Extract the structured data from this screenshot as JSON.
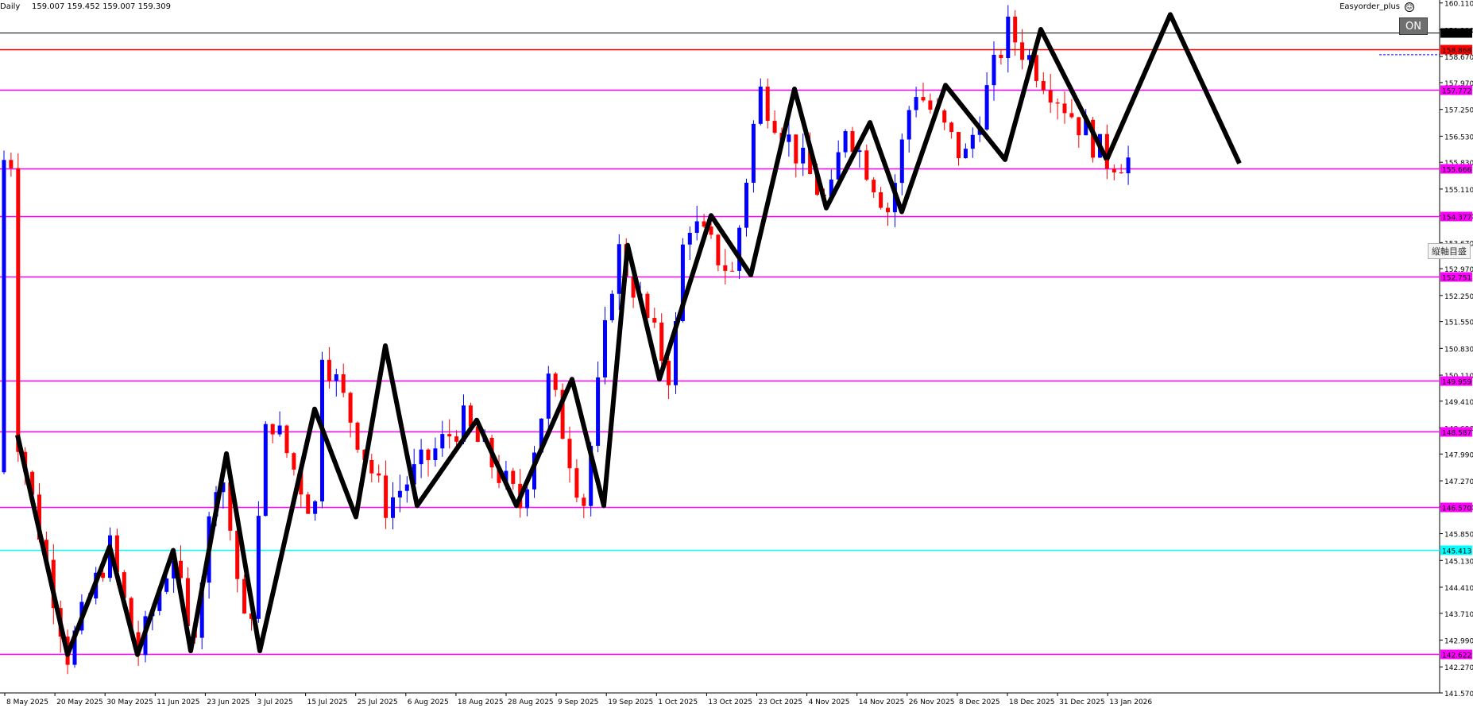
{
  "header": {
    "period": "Daily",
    "ohlc": "159.007 159.452 159.007 159.309"
  },
  "ea": {
    "name": "Easyorder_plus",
    "status_button": "ON"
  },
  "side_button_label": "縦軸目盛",
  "colors": {
    "bull": "#0000ff",
    "bear": "#ff0000",
    "level_line": "#ff00ff",
    "cyan_line": "#00ffff",
    "current_line": "#000000",
    "bid_line": "#ff0000",
    "zigzag": "#000000"
  },
  "chart_data": {
    "type": "candlestick",
    "ylim": [
      141.57,
      160.19
    ],
    "y_ticks": [
      141.57,
      142.27,
      142.99,
      143.71,
      144.41,
      145.13,
      145.85,
      146.57,
      147.27,
      147.99,
      148.69,
      149.41,
      150.11,
      150.83,
      151.55,
      152.25,
      152.97,
      153.67,
      154.39,
      155.11,
      155.83,
      156.53,
      157.25,
      157.97,
      158.67,
      159.39,
      160.11
    ],
    "x_labels": [
      "8 May 2025",
      "20 May 2025",
      "30 May 2025",
      "11 Jun 2025",
      "23 Jun 2025",
      "3 Jul 2025",
      "15 Jul 2025",
      "25 Jul 2025",
      "6 Aug 2025",
      "18 Aug 2025",
      "28 Aug 2025",
      "9 Sep 2025",
      "19 Sep 2025",
      "1 Oct 2025",
      "13 Oct 2025",
      "23 Oct 2025",
      "4 Nov 2025",
      "14 Nov 2025",
      "26 Nov 2025",
      "8 Dec 2025",
      "18 Dec 2025",
      "31 Dec 2025",
      "13 Jan 2026"
    ],
    "horizontal_levels": [
      {
        "value": 159.309,
        "label": "159.309",
        "kind": "current"
      },
      {
        "value": 158.868,
        "label": "158.868",
        "kind": "bid"
      },
      {
        "value": 157.772,
        "label": "157.772",
        "kind": "level"
      },
      {
        "value": 155.666,
        "label": "155.666",
        "kind": "level"
      },
      {
        "value": 154.377,
        "label": "154.377",
        "kind": "level"
      },
      {
        "value": 152.751,
        "label": "152.751",
        "kind": "level"
      },
      {
        "value": 149.959,
        "label": "149.959",
        "kind": "level"
      },
      {
        "value": 148.587,
        "label": "148.587",
        "kind": "level"
      },
      {
        "value": 146.57,
        "label": "146.570",
        "kind": "level"
      },
      {
        "value": 145.413,
        "label": "145.413",
        "kind": "cyan"
      },
      {
        "value": 142.622,
        "label": "142.622",
        "kind": "level"
      }
    ],
    "zigzag_anchor_closes": [
      148.5,
      142.6,
      145.5,
      142.6,
      145.4,
      142.7,
      148.0,
      142.7,
      149.2,
      146.3,
      150.9,
      146.6,
      148.9,
      146.6,
      150.0,
      146.6,
      153.6,
      150.0,
      154.4,
      152.8,
      157.8,
      154.6,
      156.9,
      154.5,
      157.9,
      155.9,
      159.4,
      155.9
    ]
  }
}
